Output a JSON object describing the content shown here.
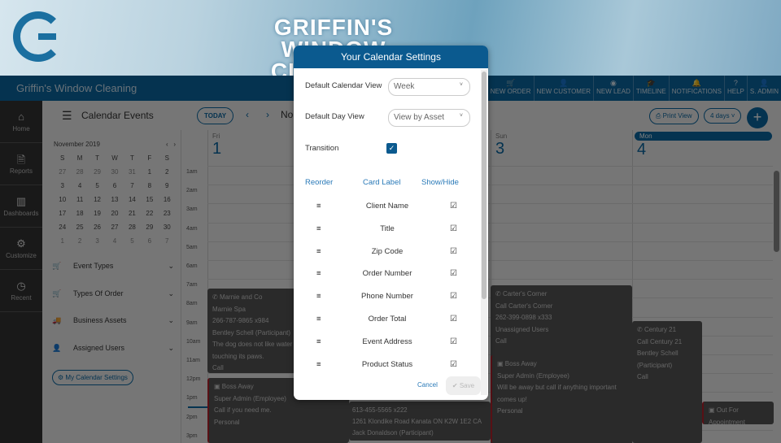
{
  "banner": {
    "brand_line1": "GRIFFIN'S",
    "brand_line2": "WINDOW CLEANING"
  },
  "app_title": "Griffin's Window Cleaning",
  "top_nav": [
    {
      "icon": "cart-icon",
      "label": "NEW ORDER"
    },
    {
      "icon": "user-plus-icon",
      "label": "NEW CUSTOMER"
    },
    {
      "icon": "target-icon",
      "label": "NEW LEAD"
    },
    {
      "icon": "graduation-cap-icon",
      "label": "TIMELINE"
    },
    {
      "icon": "bell-icon",
      "label": "NOTIFICATIONS"
    },
    {
      "icon": "help-icon",
      "label": "HELP"
    },
    {
      "icon": "user-icon",
      "label": "S. ADMIN"
    }
  ],
  "left_nav": [
    {
      "icon": "home-icon",
      "label": "Home"
    },
    {
      "icon": "document-icon",
      "label": "Reports"
    },
    {
      "icon": "bar-chart-icon",
      "label": "Dashboards"
    },
    {
      "icon": "gear-icon",
      "label": "Customize"
    },
    {
      "icon": "clock-icon",
      "label": "Recent"
    }
  ],
  "page_title": "Calendar Events",
  "toolbar": {
    "today": "TODAY",
    "range_partial": "No",
    "print": "Print View",
    "days": "4 days"
  },
  "mini_calendar": {
    "month": "November 2019",
    "weekdays": [
      "S",
      "M",
      "T",
      "W",
      "T",
      "F",
      "S"
    ],
    "weeks": [
      [
        "27",
        "28",
        "29",
        "30",
        "31",
        "1",
        "2"
      ],
      [
        "3",
        "4",
        "5",
        "6",
        "7",
        "8",
        "9"
      ],
      [
        "10",
        "11",
        "12",
        "13",
        "14",
        "15",
        "16"
      ],
      [
        "17",
        "18",
        "19",
        "20",
        "21",
        "22",
        "23"
      ],
      [
        "24",
        "25",
        "26",
        "27",
        "28",
        "29",
        "30"
      ],
      [
        "1",
        "2",
        "3",
        "4",
        "5",
        "6",
        "7"
      ]
    ]
  },
  "filters": [
    {
      "icon": "cart-icon",
      "label": "Event Types"
    },
    {
      "icon": "cart-icon",
      "label": "Types Of Order"
    },
    {
      "icon": "truck-icon",
      "label": "Business Assets"
    },
    {
      "icon": "user-icon",
      "label": "Assigned Users"
    }
  ],
  "my_calendar_settings": "My Calendar Settings",
  "days": [
    {
      "dow": "Fri",
      "num": "1"
    },
    {
      "dow": "",
      "num": ""
    },
    {
      "dow": "Sun",
      "num": "3"
    },
    {
      "dow": "Mon",
      "num": "4"
    }
  ],
  "hours": [
    "1am",
    "2am",
    "3am",
    "4am",
    "5am",
    "6am",
    "7am",
    "8am",
    "9am",
    "10am",
    "11am",
    "12pm",
    "1pm",
    "2pm",
    "3pm"
  ],
  "events": [
    {
      "title": "Carter's Corner",
      "icon": "phone-icon",
      "lines": [
        "Call Carter's Corner",
        "262-399-0898 x333",
        "Unassigned Users",
        "Call"
      ]
    },
    {
      "title": "Marnie and Co",
      "icon": "phone-icon",
      "lines": [
        "Marnie Spa",
        "266-787-9865 x984",
        "Bentley Schell (Participant)",
        "The dog does not like water or people touching its paws.",
        "Call"
      ]
    },
    {
      "title": "Boss Away",
      "icon": "badge-icon",
      "lines": [
        "Super Admin (Employee)",
        "Call if you need me.",
        "Personal"
      ]
    },
    {
      "title": "",
      "icon": "",
      "lines": [
        "613-455-5565 x222",
        "1261 Klondike Road Kanata ON K2W 1E2 CA",
        "Jack Donaldson (Participant)"
      ]
    },
    {
      "title": "Boss Away",
      "icon": "badge-icon",
      "lines": [
        "Super Admin (Employee)",
        "Will be away but call if anything important comes up!",
        "Personal"
      ]
    },
    {
      "title": "Century 21",
      "icon": "phone-icon",
      "lines": [
        "Call Century 21",
        "Bentley Schell (Participant)",
        "Call"
      ]
    },
    {
      "title": "Out For Appointment",
      "icon": "badge-icon",
      "lines": []
    }
  ],
  "modal": {
    "title": "Your Calendar Settings",
    "default_calendar_view_label": "Default Calendar View",
    "default_calendar_view": "Week",
    "default_day_view_label": "Default Day View",
    "default_day_view": "View by Asset",
    "transition_label": "Transition",
    "transition_checked": true,
    "columns": [
      "Reorder",
      "Card Label",
      "Show/Hide"
    ],
    "fields": [
      {
        "label": "Client Name",
        "shown": true
      },
      {
        "label": "Title",
        "shown": true
      },
      {
        "label": "Zip Code",
        "shown": true
      },
      {
        "label": "Order Number",
        "shown": true
      },
      {
        "label": "Phone Number",
        "shown": true
      },
      {
        "label": "Order Total",
        "shown": true
      },
      {
        "label": "Event Address",
        "shown": true
      },
      {
        "label": "Product Status",
        "shown": true
      }
    ],
    "cancel": "Cancel",
    "save": "Save"
  },
  "colors": {
    "primary": "#0a66a0",
    "modal_header": "#0b5a8f",
    "event_bar": "#b0202a"
  }
}
